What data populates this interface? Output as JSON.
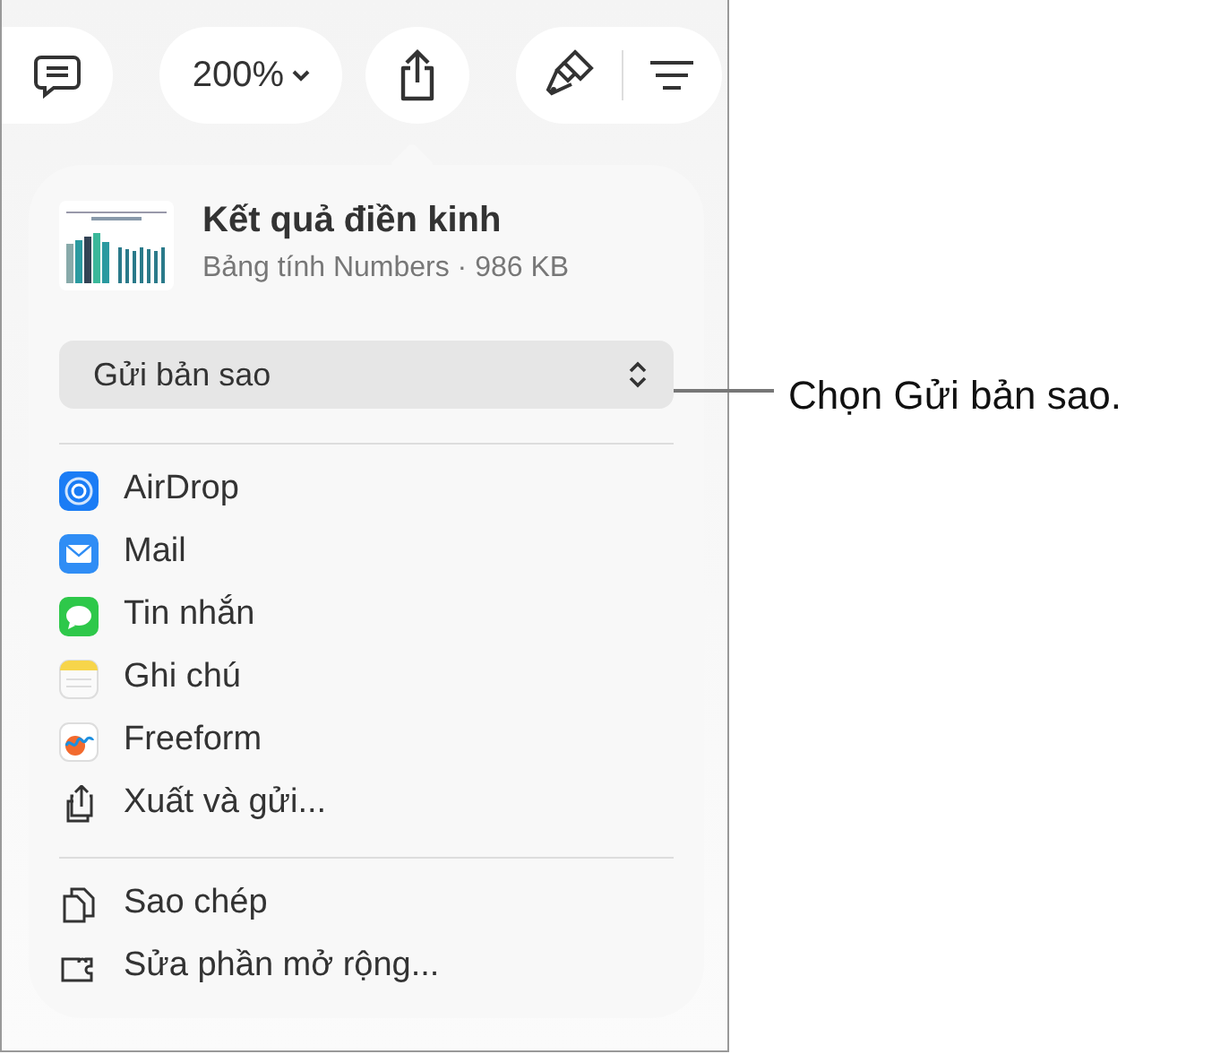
{
  "toolbar": {
    "zoom": "200%"
  },
  "file": {
    "title": "Kết quả điền kinh",
    "subtitle": "Bảng tính Numbers · 986 KB"
  },
  "send_menu": {
    "value": "Gửi bản sao"
  },
  "share_items": [
    {
      "kind": "airdrop",
      "label": "AirDrop"
    },
    {
      "kind": "mail",
      "label": "Mail"
    },
    {
      "kind": "messages",
      "label": "Tin nhắn"
    },
    {
      "kind": "notes",
      "label": "Ghi chú"
    },
    {
      "kind": "freeform",
      "label": "Freeform"
    },
    {
      "kind": "export",
      "label": "Xuất và gửi..."
    }
  ],
  "other_items": [
    {
      "kind": "copy",
      "label": "Sao chép"
    },
    {
      "kind": "extensions",
      "label": "Sửa phần mở rộng..."
    }
  ],
  "callout": {
    "text": "Chọn Gửi bản sao."
  }
}
